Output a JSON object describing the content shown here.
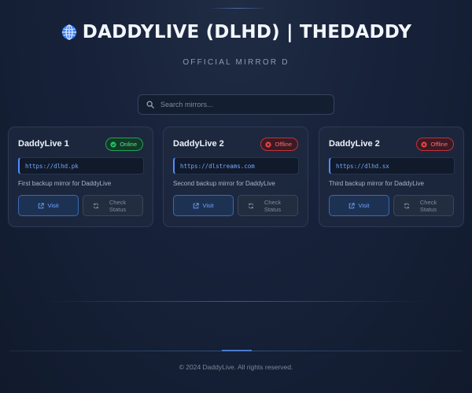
{
  "header": {
    "title": "DADDYLIVE (DLHD) | THEDADDY",
    "subtitle": "OFFICIAL MIRROR D",
    "icon": "globe-icon"
  },
  "search": {
    "placeholder": "Search mirrors...",
    "value": ""
  },
  "cards": [
    {
      "name": "DaddyLive 1",
      "status": "Online",
      "url": "https://dlhd.pk",
      "description": "First backup mirror for DaddyLive",
      "visit_label": "Visit",
      "check_label": "Check Status"
    },
    {
      "name": "DaddyLive 2",
      "status": "Offline",
      "url": "https://dlstreams.com",
      "description": "Second backup mirror for DaddyLive",
      "visit_label": "Visit",
      "check_label": "Check Status"
    },
    {
      "name": "DaddyLive 2",
      "status": "Offline",
      "url": "https://dlhd.sx",
      "description": "Third backup mirror for DaddyLive",
      "visit_label": "Visit",
      "check_label": "Check Status"
    }
  ],
  "footer": {
    "copyright": "© 2024 DaddyLive. All rights reserved."
  },
  "colors": {
    "accent": "#4f8dff",
    "online": "#22a356",
    "offline": "#e0434a",
    "background": "#17223a"
  }
}
